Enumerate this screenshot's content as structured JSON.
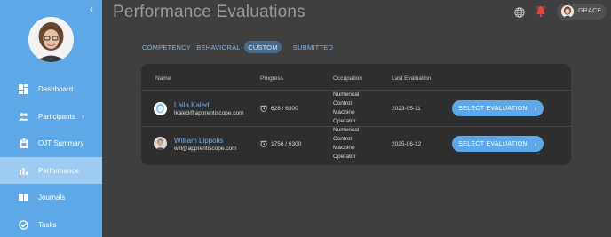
{
  "sidebar": {
    "items": [
      {
        "label": "Dashboard",
        "icon": "dashboard-icon"
      },
      {
        "label": "Participants",
        "icon": "people-icon",
        "chevron": "›"
      },
      {
        "label": "OJT Summary",
        "icon": "clipboard-icon"
      },
      {
        "label": "Performance",
        "icon": "bar-chart-icon",
        "active": true
      },
      {
        "label": "Journals",
        "icon": "book-icon"
      },
      {
        "label": "Tasks",
        "icon": "check-circle-icon"
      }
    ],
    "collapse_glyph": "‹"
  },
  "header": {
    "title": "Performance Evaluations",
    "user_name": "GRACE"
  },
  "tabs": [
    {
      "label": "COMPETENCY"
    },
    {
      "label": "BEHAVIORAL"
    },
    {
      "label": "CUSTOM",
      "active": true
    },
    {
      "label": "SUBMITTED"
    }
  ],
  "table": {
    "headers": [
      "Name",
      "Progress",
      "Occupation",
      "Last Evaluation"
    ],
    "rows": [
      {
        "name": "Laila Kaled",
        "email": "lkaled@apprentiscope.com",
        "progress": "628 / 6300",
        "occupation": [
          "Numerical",
          "Control",
          "Machine",
          "Operator"
        ],
        "last_evaluation": "2023-05-11",
        "action": "SELECT EVALUATION"
      },
      {
        "name": "William Lippolis",
        "email": "will@apprentiscope.com",
        "progress": "1756 / 6300",
        "occupation": [
          "Numerical",
          "Control",
          "Machine",
          "Operator"
        ],
        "last_evaluation": "2025-06-12",
        "action": "SELECT EVALUATION"
      }
    ]
  },
  "colors": {
    "sidebar": "#5fa8e8",
    "sidebar_active": "#9ecbf2",
    "accent": "#5fa8e8",
    "background": "#3f3f3f",
    "card": "#2e2e2e",
    "notification": "#e8453c"
  }
}
